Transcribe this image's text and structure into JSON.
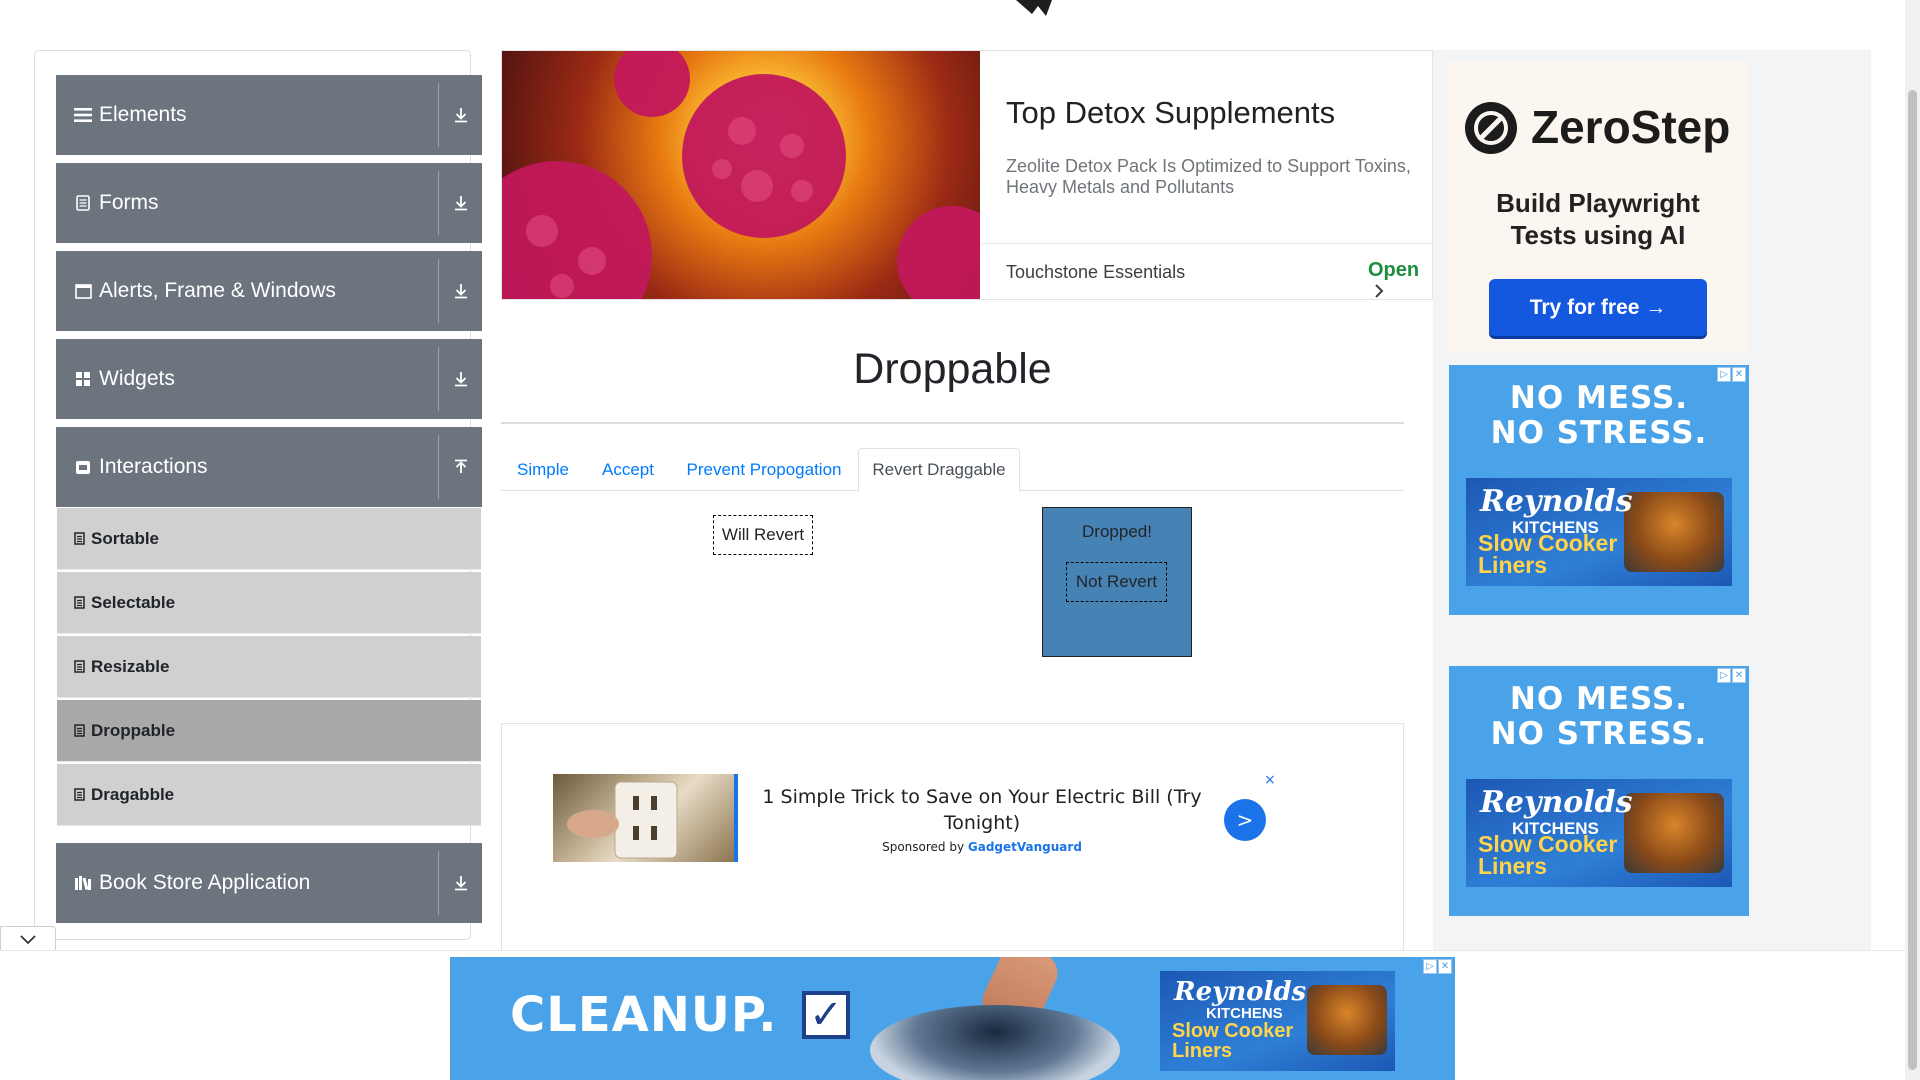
{
  "page": {
    "title": "Droppable"
  },
  "sidebar": {
    "groups": [
      {
        "label": "Elements",
        "icon": "list-icon",
        "arrow": "download-arrow-icon"
      },
      {
        "label": "Forms",
        "icon": "document-icon",
        "arrow": "download-arrow-icon"
      },
      {
        "label": "Alerts, Frame & Windows",
        "icon": "window-icon",
        "arrow": "download-arrow-icon"
      },
      {
        "label": "Widgets",
        "icon": "grid-icon",
        "arrow": "download-arrow-icon"
      },
      {
        "label": "Interactions",
        "icon": "box-icon",
        "arrow": "upload-arrow-icon"
      },
      {
        "label": "Book Store Application",
        "icon": "books-icon",
        "arrow": "download-arrow-icon"
      }
    ],
    "interactions_items": [
      {
        "label": "Sortable"
      },
      {
        "label": "Selectable"
      },
      {
        "label": "Resizable"
      },
      {
        "label": "Droppable"
      },
      {
        "label": "Dragabble"
      }
    ],
    "active_item": "Droppable"
  },
  "top_ad": {
    "title": "Top Detox Supplements",
    "description": "Zeolite Detox Pack Is Optimized to Support Toxins, Heavy Metals and Pollutants",
    "brand": "Touchstone Essentials",
    "cta": "Open"
  },
  "tabs": [
    {
      "label": "Simple"
    },
    {
      "label": "Accept"
    },
    {
      "label": "Prevent Propogation"
    },
    {
      "label": "Revert Draggable"
    }
  ],
  "active_tab": "Revert Draggable",
  "revert_demo": {
    "will_revert_label": "Will Revert",
    "not_revert_label": "Not Revert",
    "drop_label": "Dropped!",
    "drop_color": "#4682b4"
  },
  "mid_ad": {
    "headline": "1 Simple Trick to Save on Your Electric Bill (Try Tonight)",
    "sponsored_prefix": "Sponsored by",
    "sponsor": "GadgetVanguard",
    "go_label": ">",
    "close_label": "×"
  },
  "right_ads": {
    "zerostep": {
      "name": "ZeroStep",
      "tagline": "Build Playwright Tests using AI",
      "cta": "Try for free →"
    },
    "reynolds": {
      "headline_1": "NO MESS.",
      "headline_2": "NO STRESS.",
      "brand": "Reynolds",
      "sub_brand": "KITCHENS",
      "product_1": "Slow Cooker",
      "product_2": "Liners"
    }
  },
  "bottom_ad": {
    "headline": "CLEANUP.",
    "check": "✓",
    "brand": "Reynolds",
    "sub_brand": "KITCHENS",
    "product_1": "Slow Cooker",
    "product_2": "Liners"
  },
  "colors": {
    "sidebar_group": "#6c757d",
    "sidebar_item": "#d0d0d0",
    "sidebar_item_active": "#a9a9a9",
    "link": "#007bff",
    "ad_open": "#1e8e3e"
  }
}
